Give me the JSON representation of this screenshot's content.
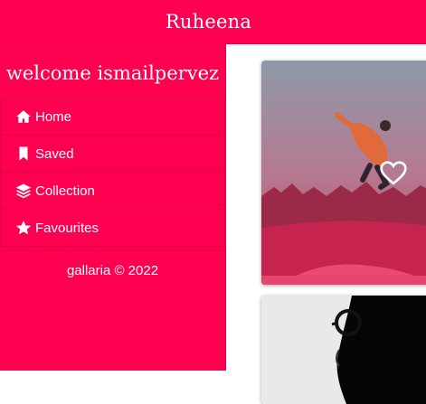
{
  "app": {
    "brand": "Ruheena"
  },
  "sidebar": {
    "welcome": "welcome ismailpervez",
    "items": [
      {
        "label": "Home",
        "icon": "home-icon"
      },
      {
        "label": "Saved",
        "icon": "bookmark-icon"
      },
      {
        "label": "Collection",
        "icon": "layers-icon"
      },
      {
        "label": "Favourites",
        "icon": "star-icon"
      }
    ],
    "footer": "gallaria © 2022"
  },
  "colors": {
    "brand": "#ff0050",
    "surface": "#ffffff"
  }
}
